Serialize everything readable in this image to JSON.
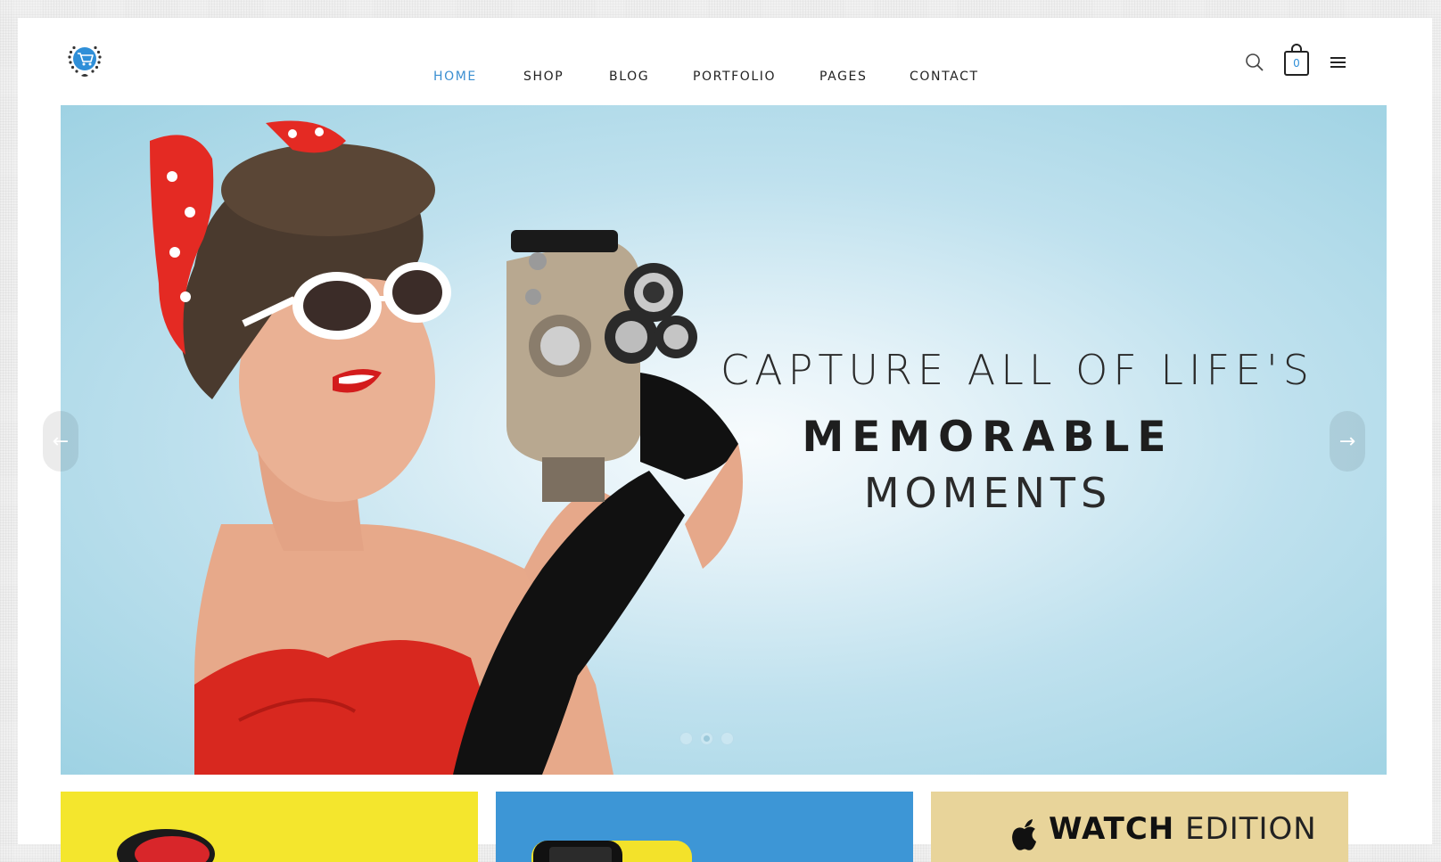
{
  "header": {
    "logo_icon": "cart-laurel-logo",
    "nav": [
      {
        "label": "HOME",
        "active": true
      },
      {
        "label": "SHOP",
        "active": false
      },
      {
        "label": "BLOG",
        "active": false
      },
      {
        "label": "PORTFOLIO",
        "active": false
      },
      {
        "label": "PAGES",
        "active": false
      },
      {
        "label": "CONTACT",
        "active": false
      }
    ],
    "search_icon": "search-icon",
    "cart_count": "0",
    "menu_icon": "hamburger-icon"
  },
  "hero": {
    "line1": "CAPTURE ALL OF LIFE'S",
    "line2": "MEMORABLE",
    "line3": "MOMENTS",
    "slides": 3,
    "active_slide": 2,
    "prev_arrow": "←",
    "next_arrow": "→"
  },
  "tiles": [
    {
      "title_bold": "",
      "title_thin": ""
    },
    {
      "title_bold": "",
      "title_thin": ""
    },
    {
      "title_bold": "WATCH",
      "title_thin": "EDITION"
    }
  ],
  "colors": {
    "accent": "#3b8fd1",
    "hero_bg": "#9ed2e3",
    "tile_yellow": "#f4e62d",
    "tile_blue": "#3d96d6",
    "tile_sand": "#e8d49a"
  }
}
